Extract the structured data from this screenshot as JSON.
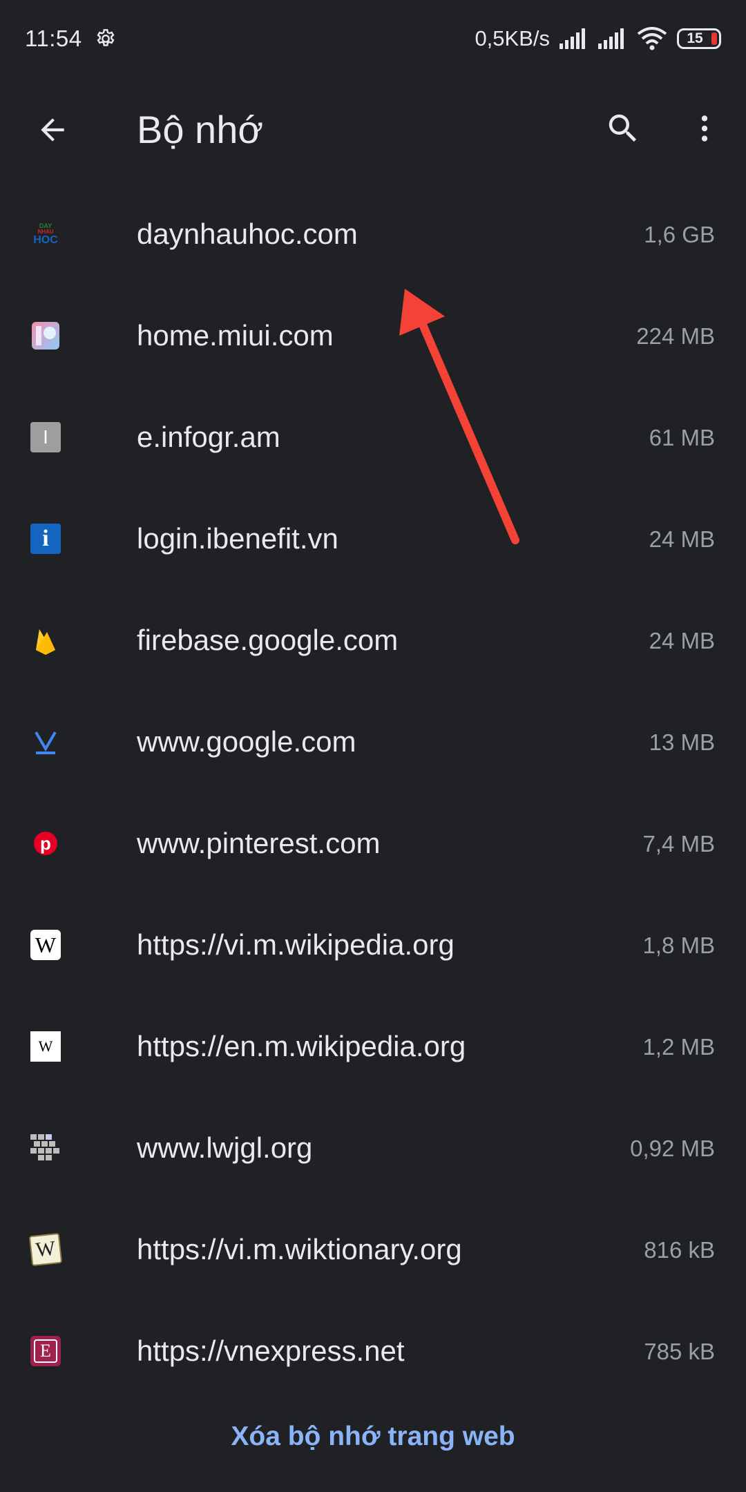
{
  "status_bar": {
    "time": "11:54",
    "net_speed": "0,5KB/s",
    "battery_level": "15",
    "icons": [
      "settings-gear-icon",
      "signal-icon",
      "signal-icon",
      "wifi-icon",
      "battery-icon"
    ]
  },
  "app_bar": {
    "title": "Bộ nhớ",
    "icons": [
      "back-arrow-icon",
      "search-icon",
      "more-vert-icon"
    ]
  },
  "sites": [
    {
      "name": "daynhauhoc.com",
      "size": "1,6 GB",
      "favicon_icon": "daynhauhoc-favicon-icon",
      "favicon_text": [
        "DAY",
        "NHAU",
        "HOC"
      ]
    },
    {
      "name": "home.miui.com",
      "size": "224 MB",
      "favicon_icon": "miui-favicon-icon"
    },
    {
      "name": "e.infogr.am",
      "size": "61 MB",
      "favicon_icon": "infogram-favicon-icon",
      "favicon_text": "I"
    },
    {
      "name": "login.ibenefit.vn",
      "size": "24 MB",
      "favicon_icon": "ibenefit-favicon-icon",
      "favicon_text": "i"
    },
    {
      "name": "firebase.google.com",
      "size": "24 MB",
      "favicon_icon": "firebase-favicon-icon"
    },
    {
      "name": "www.google.com",
      "size": "13 MB",
      "favicon_icon": "google-favicon-icon"
    },
    {
      "name": "www.pinterest.com",
      "size": "7,4 MB",
      "favicon_icon": "pinterest-favicon-icon",
      "favicon_text": "p"
    },
    {
      "name": "https://vi.m.wikipedia.org",
      "size": "1,8 MB",
      "favicon_icon": "wikipedia-favicon-icon",
      "favicon_text": "W"
    },
    {
      "name": "https://en.m.wikipedia.org",
      "size": "1,2 MB",
      "favicon_icon": "wikipedia-favicon-icon",
      "favicon_text": "W"
    },
    {
      "name": "www.lwjgl.org",
      "size": "0,92 MB",
      "favicon_icon": "lwjgl-favicon-icon"
    },
    {
      "name": "https://vi.m.wiktionary.org",
      "size": "816 kB",
      "favicon_icon": "wiktionary-favicon-icon",
      "favicon_text": "W"
    },
    {
      "name": "https://vnexpress.net",
      "size": "785 kB",
      "favicon_icon": "vnexpress-favicon-icon",
      "favicon_text": "E"
    }
  ],
  "clear_label": "Xóa bộ nhớ trang web",
  "colors": {
    "background": "#202124",
    "text_primary": "#e8eaed",
    "text_secondary": "#9aa0a6",
    "link": "#8ab4f8",
    "annotation_arrow": "#f44336"
  }
}
